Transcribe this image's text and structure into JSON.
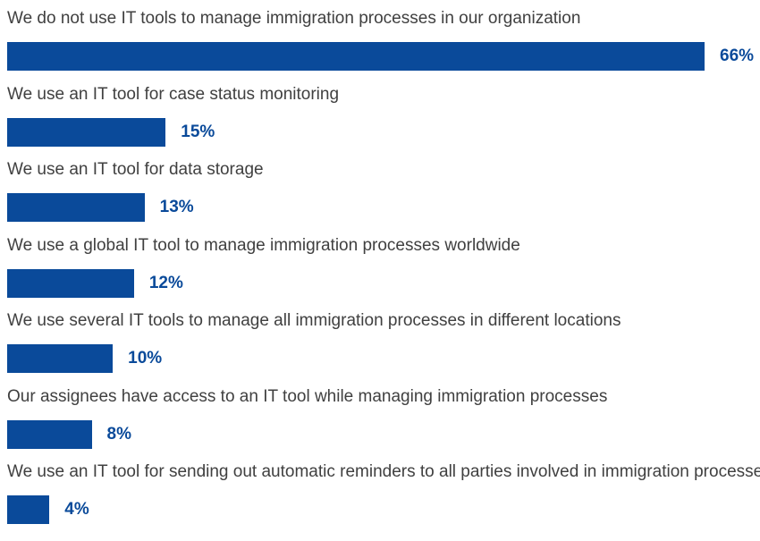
{
  "chart_data": {
    "type": "bar",
    "orientation": "horizontal",
    "title": "",
    "xlabel": "",
    "ylabel": "",
    "xlim": [
      0,
      66
    ],
    "grid": false,
    "legend": "none",
    "bar_color": "#0a4a9a",
    "value_label_color": "#0a4a9a",
    "categories": [
      "We do not use IT tools to manage immigration processes in our organization",
      "We use an IT tool for case status monitoring",
      "We use an IT tool for data storage",
      "We use a global IT tool to manage immigration processes worldwide",
      "We use several IT tools to manage all immigration processes in different locations",
      "Our assignees have access to an IT tool while managing immigration processes",
      "We use an IT tool for sending out automatic reminders to all parties involved in immigration processes"
    ],
    "values": [
      66,
      15,
      13,
      12,
      10,
      8,
      4
    ],
    "value_labels": [
      "66%",
      "15%",
      "13%",
      "12%",
      "10%",
      "8%",
      "4%"
    ]
  }
}
